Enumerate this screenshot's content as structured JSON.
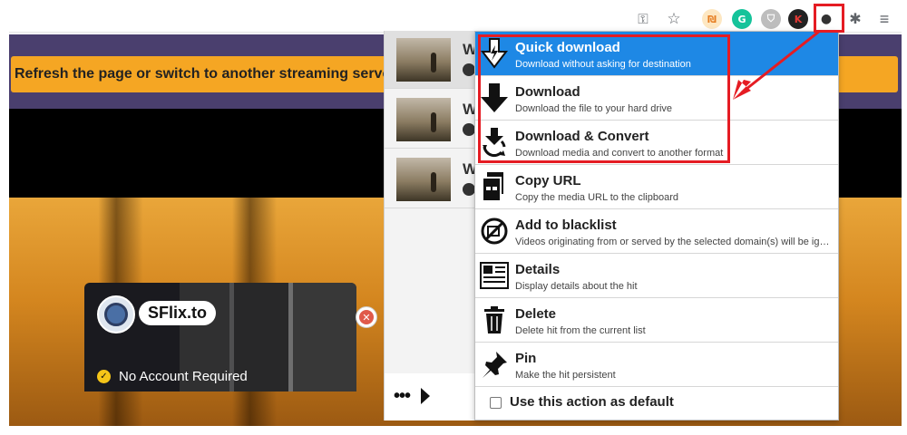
{
  "toolbar": {
    "extensions": [
      {
        "name": "key",
        "glyph": "⚿"
      },
      {
        "name": "bookmark-star",
        "glyph": "☆"
      },
      {
        "name": "extension-1",
        "glyph": "₪",
        "color": "#f39c12"
      },
      {
        "name": "grammarly",
        "glyph": "G",
        "color": "#15c39a"
      },
      {
        "name": "shield",
        "glyph": "⛉",
        "color": "#9e9e9e"
      },
      {
        "name": "extension-k",
        "glyph": "K",
        "color": "#222222"
      },
      {
        "name": "video-downloader",
        "glyph": "●",
        "color": "#333333"
      },
      {
        "name": "puzzle",
        "glyph": "✱"
      },
      {
        "name": "media-controls",
        "glyph": "≡"
      }
    ]
  },
  "page": {
    "alert_text": "Refresh the page or switch to another streaming server."
  },
  "ad": {
    "brand": "SFlix.to",
    "tagline": "No Account Required",
    "check_glyph": "✓",
    "close_glyph": "✕"
  },
  "hits": [
    {
      "title_initial": "W"
    },
    {
      "title_initial": "W"
    },
    {
      "title_initial": "W"
    }
  ],
  "popup_footer": {
    "more_label": "•••"
  },
  "menu": {
    "items": [
      {
        "title": "Quick download",
        "desc": "Download without asking for destination"
      },
      {
        "title": "Download",
        "desc": "Download the file to your hard drive"
      },
      {
        "title": "Download & Convert",
        "desc": "Download media and convert to another format"
      },
      {
        "title": "Copy URL",
        "desc": "Copy the media URL to the clipboard"
      },
      {
        "title": "Add to blacklist",
        "desc": "Videos originating from or served by the selected domain(s) will be ignor..."
      },
      {
        "title": "Details",
        "desc": "Display details about the hit"
      },
      {
        "title": "Delete",
        "desc": "Delete hit from the current list"
      },
      {
        "title": "Pin",
        "desc": "Make the hit persistent"
      }
    ],
    "default_label": "Use this action as default"
  },
  "colors": {
    "accent": "#1e88e5",
    "annotation": "#e51c23",
    "alert": "#f5a623"
  }
}
